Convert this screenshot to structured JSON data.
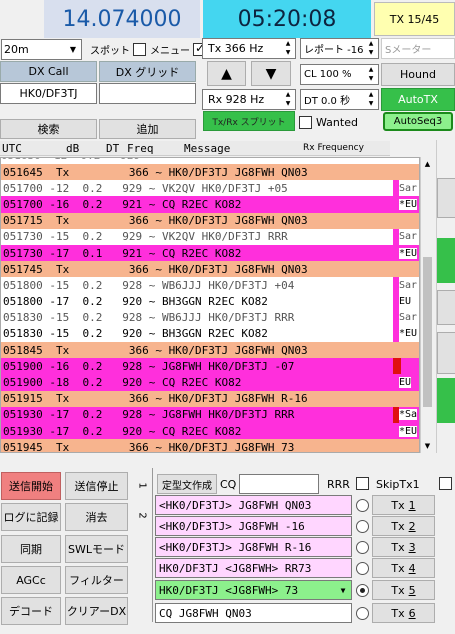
{
  "header": {
    "frequency": "14.074000",
    "time": "05:20:08",
    "tx_status": "TX 15/45"
  },
  "controls": {
    "band": "20m",
    "spot_label": "スポット",
    "menu_label": "メニュー",
    "tx_freq": "Tx  366  Hz",
    "report": "レポート -16",
    "smeter_placeholder": "Sメーター",
    "dx_call_label": "DX Call",
    "dx_grid_label": "DX グリッド",
    "dx_call_value": "HK0/DF3TJ",
    "dx_grid_value": "",
    "cl_value": "CL  100 %",
    "hound_label": "Hound",
    "up_glyph": "▲",
    "down_glyph": "▼",
    "rx_freq": "Rx  928  Hz",
    "dt_value": "DT 0.0 秒",
    "autotx_label": "AutoTX",
    "search_label": "検索",
    "add_label": "追加",
    "split_label": "Tx/Rx スプリット",
    "wanted_label": "Wanted",
    "autoseq_label": "AutoSeq3"
  },
  "colors": {
    "freq_bg": "#d8dfee",
    "freq_text": "#1a5aa8",
    "time_bg": "#44d6f0",
    "tx_status_bg": "#ffffb0",
    "tx_row": "#f7b48e",
    "cq_row": "#ff2fdc",
    "green": "#36c04a",
    "green_light": "#8cf08c",
    "pink": "#ffd6ff",
    "red_button": "#f08080"
  },
  "table": {
    "headers": [
      "UTC",
      "dB",
      "DT",
      "Freq",
      "Message"
    ],
    "rx_frequency_label": "Rx Frequency",
    "rows": [
      {
        "text": "051645  Tx         366 ~ HK0/DF3TJ JG8FWH QN03",
        "kind": "tx",
        "side": ""
      },
      {
        "text": "051700 -12  0.2   929 ~ VK2QV HK0/DF3TJ +05",
        "kind": "rx",
        "side": "Sar"
      },
      {
        "text": "051700 -16  0.2   921 ~ CQ R2EC KO82",
        "kind": "cq",
        "side": "*EU"
      },
      {
        "text": "051715  Tx         366 ~ HK0/DF3TJ JG8FWH QN03",
        "kind": "tx",
        "side": ""
      },
      {
        "text": "051730 -15  0.2   929 ~ VK2QV HK0/DF3TJ RRR",
        "kind": "rx",
        "side": "Sar"
      },
      {
        "text": "051730 -17  0.1   921 ~ CQ R2EC KO82",
        "kind": "cq",
        "side": "*EU"
      },
      {
        "text": "051745  Tx         366 ~ HK0/DF3TJ JG8FWH QN03",
        "kind": "tx",
        "side": ""
      },
      {
        "text": "051800 -15  0.2   928 ~ WB6JJJ HK0/DF3TJ +04",
        "kind": "rx",
        "side": "Sar"
      },
      {
        "text": "051800 -17  0.2   920 ~ BH3GGN R2EC KO82",
        "kind": "rx2",
        "side": "EU"
      },
      {
        "text": "051830 -15  0.2   928 ~ WB6JJJ HK0/DF3TJ RRR",
        "kind": "rx",
        "side": "Sar"
      },
      {
        "text": "051830 -15  0.2   920 ~ BH3GGN R2EC KO82",
        "kind": "rx2",
        "side": "*EU"
      },
      {
        "text": "051845  Tx         366 ~ HK0/DF3TJ JG8FWH QN03",
        "kind": "tx",
        "side": ""
      },
      {
        "text": "051900 -16  0.2   928 ~ JG8FWH HK0/DF3TJ -07",
        "kind": "me",
        "side": ""
      },
      {
        "text": "051900 -18  0.2   920 ~ CQ R2EC KO82",
        "kind": "cq",
        "side": "EU"
      },
      {
        "text": "051915  Tx         366 ~ HK0/DF3TJ JG8FWH R-16",
        "kind": "tx",
        "side": ""
      },
      {
        "text": "051930 -17  0.2   928 ~ JG8FWH HK0/DF3TJ RRR",
        "kind": "me",
        "side": "*Sa"
      },
      {
        "text": "051930 -17  0.2   920 ~ CQ R2EC KO82",
        "kind": "cq",
        "side": "*EU"
      },
      {
        "text": "051945  Tx         366 ~ HK0/DF3TJ JG8FWH 73",
        "kind": "tx",
        "side": ""
      }
    ]
  },
  "bottom": {
    "left_buttons": [
      [
        "送信開始",
        "送信停止"
      ],
      [
        "ログに記録",
        "消去"
      ],
      [
        "同期",
        "SWLモード"
      ],
      [
        "AGCc",
        "フィルター"
      ],
      [
        "デコード",
        "クリアーDX"
      ]
    ],
    "template_label": "定型文作成",
    "cq_label": "CQ",
    "cq_value": "",
    "rrr_label": "RRR",
    "skip_label": "SkipTx1",
    "tab1": "1",
    "tab2": "2",
    "tx_rows": [
      {
        "msg": "<HK0/DF3TJ> JG8FWH QN03",
        "btn": "Tx",
        "num": "1"
      },
      {
        "msg": "<HK0/DF3TJ> JG8FWH -16",
        "btn": "Tx",
        "num": "2"
      },
      {
        "msg": "<HK0/DF3TJ> JG8FWH R-16",
        "btn": "Tx",
        "num": "3"
      },
      {
        "msg": "HK0/DF3TJ <JG8FWH> RR73",
        "btn": "Tx",
        "num": "4"
      },
      {
        "msg": "HK0/DF3TJ <JG8FWH> 73",
        "btn": "Tx",
        "num": "5"
      },
      {
        "msg": "CQ JG8FWH QN03",
        "btn": "Tx",
        "num": "6"
      }
    ]
  }
}
